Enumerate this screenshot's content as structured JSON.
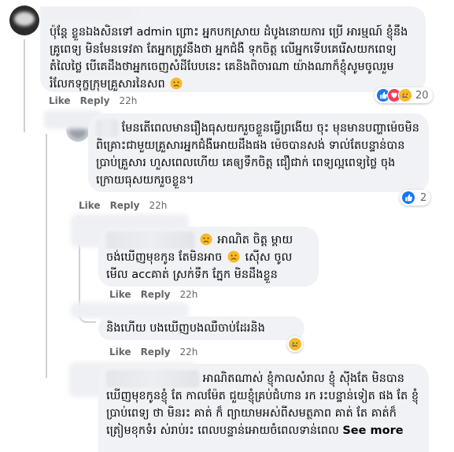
{
  "comments": [
    {
      "id": "c1",
      "text": "ប៉ុន្តែ ខ្លួនឯងសិនទៅ admin ព្រោះ អ្នកបកស្រាយ ដំបូងនោយការ ប្រើ អារម្មណ៍ ខ្ញុំនឹងគ្រូពេទ្យ មិនមែនទេវតា តែអ្នកត្រូវនឹងថា អ្នកជំងឺ ទុកចិត្ត លើអ្នកទើបគេរើសយកពេទ្យតំលៃថ្លៃ បើគេដឹងថាអ្នកចេញសំដីបែបនេះ គេនិងពិចារណា យ៉ាងណាក៏ខ្ញុំសូមចូលរួមរំលែកទុក្ខក្រុមគ្រួសារនៃសព",
      "like_label": "Like",
      "reply_label": "Reply",
      "time": "22h",
      "reaction_count": "20",
      "reaction_icons": [
        "like-icon",
        "love-icon",
        "sad-icon"
      ]
    },
    {
      "id": "c2",
      "text": "មែនតើពេលមានរឿងធុសយករួចខ្លួនធ្វើព្រងើយ ចុះ មុនមានបញ្ហាម៉េចមិនពិគ្រោះជាមួយគ្រួសារអ្នកជំងឺអោយដឹងផង ម៉េចបានសង់ ទាល់តែបន្ទាន់បានប្រាប់គ្រួសារ ហួសពេលហើយ គេឲ្យទឹកចិត្ត ជឿជាក់ ពេទ្យល្អពេទ្យថ្លៃ ចុងក្រោយធុសយករួចខ្លួន។",
      "like_label": "Like",
      "reply_label": "Reply",
      "time": "22h",
      "reaction_count": "2",
      "reaction_icons": [
        "like-icon"
      ]
    },
    {
      "id": "c3",
      "text_a": "អាណិត ចិត្ត ម្ដាយ ចង់ឃើញមុខកូន តែមិនអាច",
      "text_b": "ស៊ើស ចូលមើល accគាត់ ស្រក់ទឹក ភ្នែក មិនដឹងខ្លួន",
      "like_label": "Like",
      "reply_label": "Reply",
      "time": "22h"
    },
    {
      "id": "c4",
      "text": "និងហើយ បងឃើញបងឈឺចាប់ដែរនិង",
      "like_label": "Like",
      "reply_label": "Reply",
      "time": "22h"
    },
    {
      "id": "c5",
      "text": "អាណិតណាស់ ខ្ញុំកាលសំរាល ខ្ញុំ ស៊ីងតែ មិនបានឃើញមុខកូនខ្ញុំ តែ កាលម៉ែត ជួយខ្ញុំគ្រប់ជំហាន រក រះបន្ទាន់ទៀត ផង តែ ខ្ញុំ ប្រាប់ពេទ្យ ថា មិនរះ គាត់ ក៏ ព្យាយាមអស់ពីសមត្ថភាព គាត់ តែ គាត់ក៏ត្រៀមខុកទំរ ស់រាប់រះ ពេលបន្ទាន់អោយចំពេលទាន់ពេល",
      "see_more": "See more"
    }
  ]
}
